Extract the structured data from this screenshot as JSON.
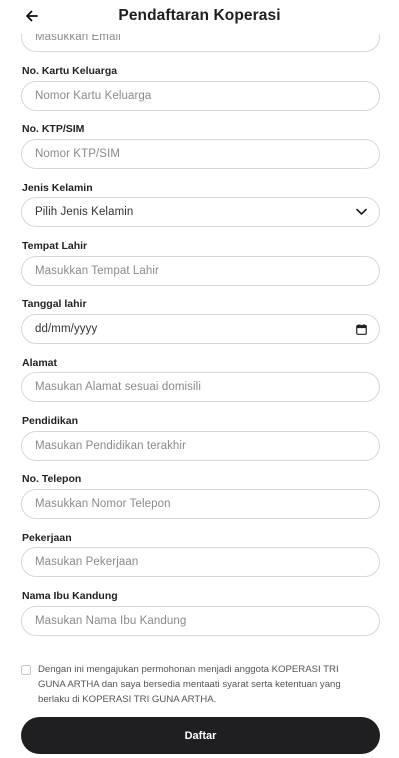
{
  "header": {
    "title": "Pendaftaran Koperasi",
    "back_icon": "arrow-left-icon"
  },
  "fields": {
    "email": {
      "placeholder": "Masukkan Email"
    },
    "kk": {
      "label": "No. Kartu Keluarga",
      "placeholder": "Nomor Kartu Keluarga"
    },
    "ktp": {
      "label": "No. KTP/SIM",
      "placeholder": "Nomor KTP/SIM"
    },
    "gender": {
      "label": "Jenis Kelamin",
      "value": "Pilih Jenis Kelamin"
    },
    "birthplace": {
      "label": "Tempat Lahir",
      "placeholder": "Masukkan Tempat Lahir"
    },
    "birthdate": {
      "label": "Tanggal lahir",
      "value": "dd/mm/yyyy"
    },
    "address": {
      "label": "Alamat",
      "placeholder": "Masukan Alamat sesuai domisili"
    },
    "education": {
      "label": "Pendidikan",
      "placeholder": "Masukan Pendidikan terakhir"
    },
    "phone": {
      "label": "No. Telepon",
      "placeholder": "Masukkan Nomor Telepon"
    },
    "job": {
      "label": "Pekerjaan",
      "placeholder": "Masukan Pekerjaan"
    },
    "mother": {
      "label": "Nama Ibu Kandung",
      "placeholder": "Masukan Nama Ibu Kandung"
    }
  },
  "terms": {
    "text": "Dengan ini mengajukan permohonan menjadi anggota KOPERASI TRI GUNA ARTHA dan saya bersedia mentaati syarat serta ketentuan yang berlaku di KOPERASI TRI GUNA ARTHA.",
    "checked": false
  },
  "submit_label": "Daftar",
  "colors": {
    "button": "#1f1f22",
    "border": "#d7d7d7",
    "placeholder": "#8a8a8a"
  }
}
